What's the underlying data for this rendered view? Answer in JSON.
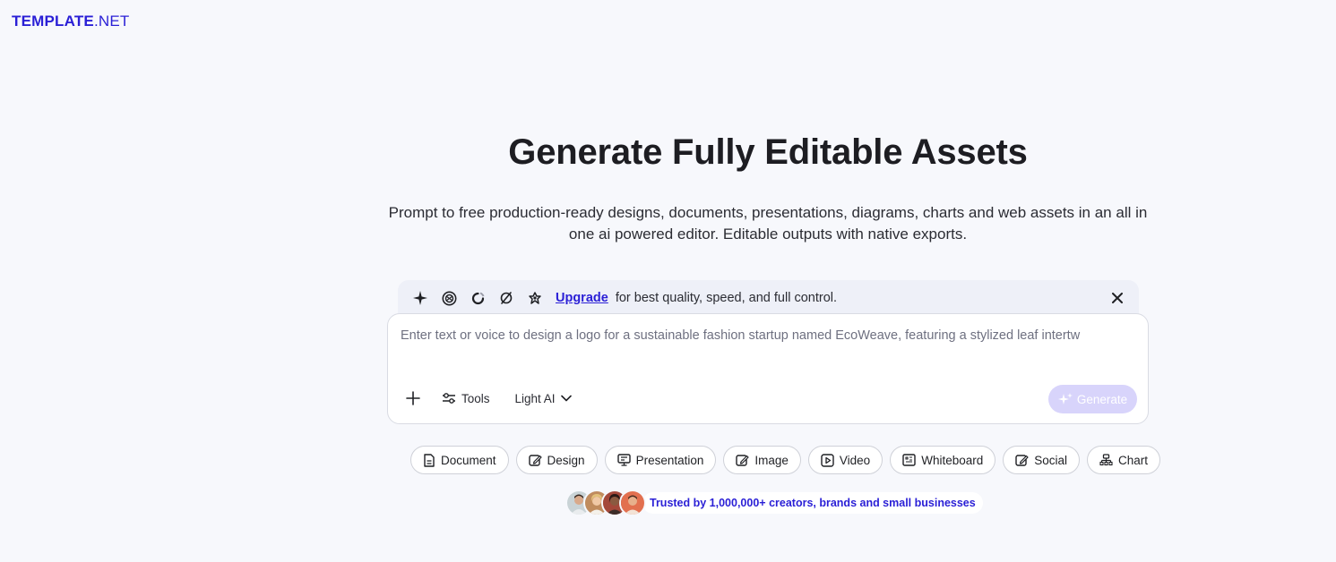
{
  "logo": {
    "brand": "TEMPLATE",
    "tld": ".NET"
  },
  "hero": {
    "title": "Generate Fully Editable Assets",
    "subtitle": "Prompt to free production-ready designs, documents, presentations, diagrams, charts and web assets in an all in one ai powered editor. Editable outputs with native exports."
  },
  "upgrade_bar": {
    "model_icons": [
      "sparkle-icon",
      "openai-icon",
      "circle-loop-icon",
      "swirl-icon",
      "flower-icon"
    ],
    "link_label": "Upgrade",
    "message": "for best quality, speed, and full control.",
    "close_icon": "close-icon"
  },
  "prompt": {
    "placeholder": "Enter text or voice to design a logo for a sustainable fashion startup named EcoWeave, featuring a stylized leaf intertw",
    "tools_label": "Tools",
    "model_label": "Light AI",
    "generate_label": "Generate"
  },
  "chips": [
    {
      "label": "Document",
      "icon": "document-icon"
    },
    {
      "label": "Design",
      "icon": "design-icon"
    },
    {
      "label": "Presentation",
      "icon": "presentation-icon"
    },
    {
      "label": "Image",
      "icon": "image-icon"
    },
    {
      "label": "Video",
      "icon": "video-icon"
    },
    {
      "label": "Whiteboard",
      "icon": "whiteboard-icon"
    },
    {
      "label": "Social",
      "icon": "social-icon"
    },
    {
      "label": "Chart",
      "icon": "chart-icon"
    }
  ],
  "trust": {
    "text": "Trusted by 1,000,000+ creators, brands and small businesses"
  },
  "colors": {
    "accent": "#2a1fd6",
    "background": "#f7f8fc",
    "generate_disabled": "#d8d4fb"
  }
}
